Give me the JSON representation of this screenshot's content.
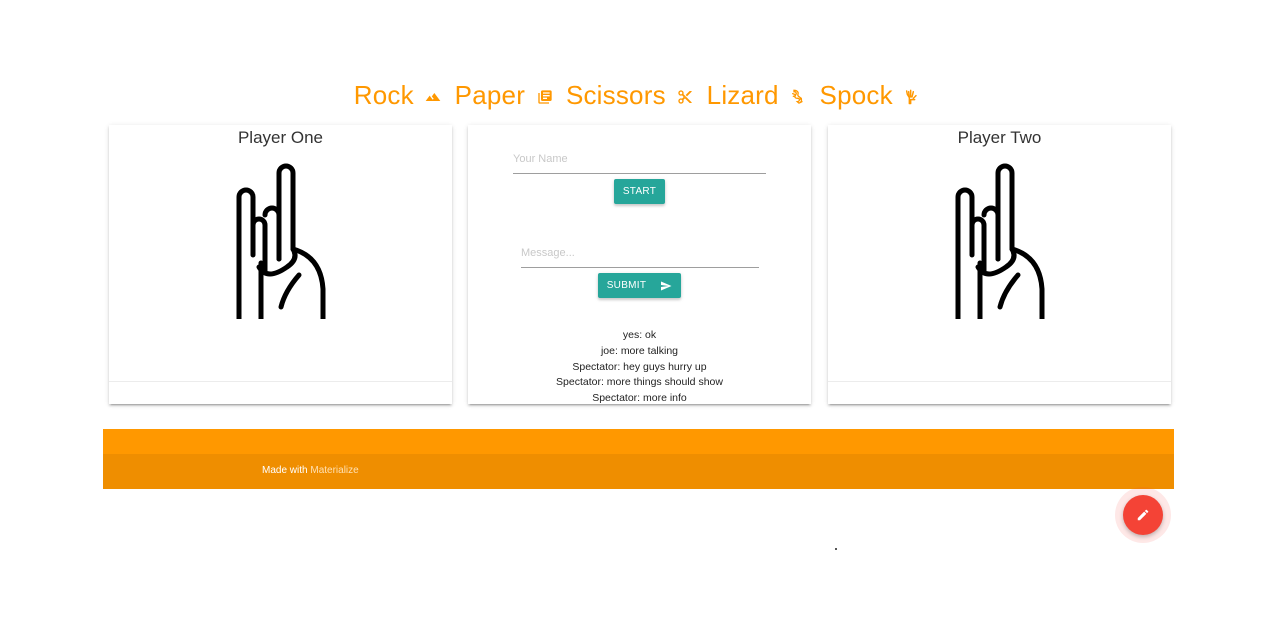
{
  "header": {
    "words": [
      "Rock",
      "Paper",
      "Scissors",
      "Lizard",
      "Spock"
    ],
    "icons": [
      "landscape-icon",
      "book-icon",
      "scissors-icon",
      "lizard-icon",
      "spock-hand-icon"
    ],
    "accent_color": "#ff9800"
  },
  "player_one": {
    "title": "Player One",
    "icon": "rock-on-hand-icon"
  },
  "player_two": {
    "title": "Player Two",
    "icon": "rock-on-hand-icon"
  },
  "center": {
    "name_placeholder": "Your Name",
    "start_label": "START",
    "message_placeholder": "Message...",
    "submit_label": "SUBMIT",
    "messages": [
      "yes: ok",
      "joe: more talking",
      "Spectator: hey guys hurry up",
      "Spectator: more things should show",
      "Spectator: more info"
    ]
  },
  "footer": {
    "prefix": "Made with",
    "link": "Materialize",
    "colors": {
      "top": "#ff9800",
      "bottom": "#ef8e00"
    }
  },
  "fab": {
    "icon": "pencil-icon",
    "color": "#f44336"
  },
  "button_color": "#26a69a"
}
